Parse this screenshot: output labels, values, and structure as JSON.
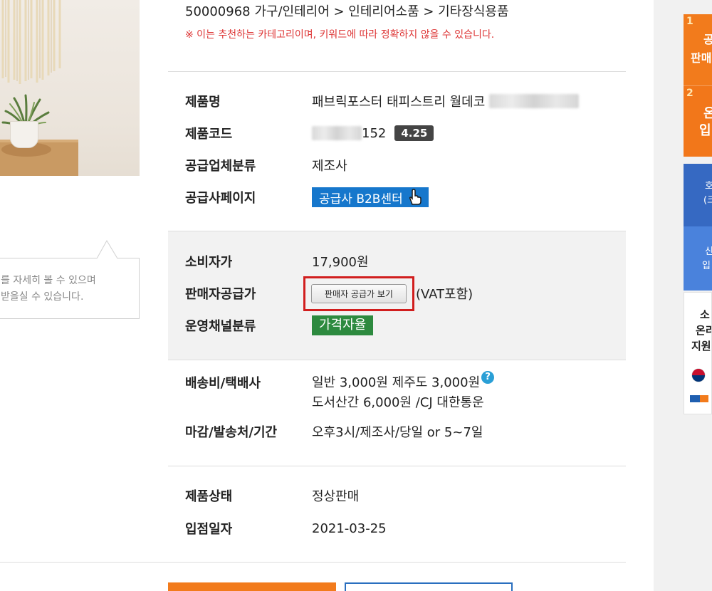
{
  "breadcrumb": "50000968 가구/인테리어 > 인테리어소품 > 기타장식용품",
  "category_notice": "※ 이는 추천하는 카테고리이며, 키워드에 따라 정확하지 않을 수 있습니다.",
  "tooltip": {
    "line1": "를 자세히 볼 수 있으며",
    "line2": "받을실 수 있습니다."
  },
  "product": {
    "name_label": "제품명",
    "name_value": "패브릭포스터 태피스트리 월데코",
    "code_label": "제품코드",
    "code_value": "152",
    "code_badge": "4.25",
    "supplier_type_label": "공급업체분류",
    "supplier_type_value": "제조사",
    "supplier_page_label": "공급사페이지",
    "supplier_page_button": "공급사 B2B센터"
  },
  "price": {
    "consumer_label": "소비자가",
    "consumer_value": "17,900원",
    "seller_label": "판매자공급가",
    "seller_button": "판매자 공급가 보기",
    "vat_note": "(VAT포함)",
    "channel_label": "운영채널분류",
    "channel_badge": "가격자율"
  },
  "shipping": {
    "fee_label": "배송비/택배사",
    "fee_line1": "일반 3,000원 제주도 3,000원",
    "help_icon": "?",
    "fee_line2": "도서산간 6,000원 /CJ 대한통운",
    "deadline_label": "마감/발송처/기간",
    "deadline_value": "오후3시/제조사/당일 or 5~7일"
  },
  "status": {
    "state_label": "제품상태",
    "state_value": "정상판매",
    "date_label": "입점일자",
    "date_value": "2021-03-25"
  },
  "sidebar": {
    "item1_num": "1",
    "item1_a": "공",
    "item1_b": "판매",
    "item2_num": "2",
    "item2_a": "온",
    "item2_b": "입",
    "blue1_a": "호",
    "blue1_b": "(크",
    "blue2_a": "신",
    "blue2_b": "입",
    "white_a": "소",
    "white_b": "온리",
    "white_c": "지원"
  },
  "colors": {
    "accent_orange": "#f27b1c",
    "b2b_blue": "#1677cc",
    "channel_green": "#2d8a3f",
    "highlight_red": "#d11e1e",
    "notice_red": "#d33333"
  }
}
